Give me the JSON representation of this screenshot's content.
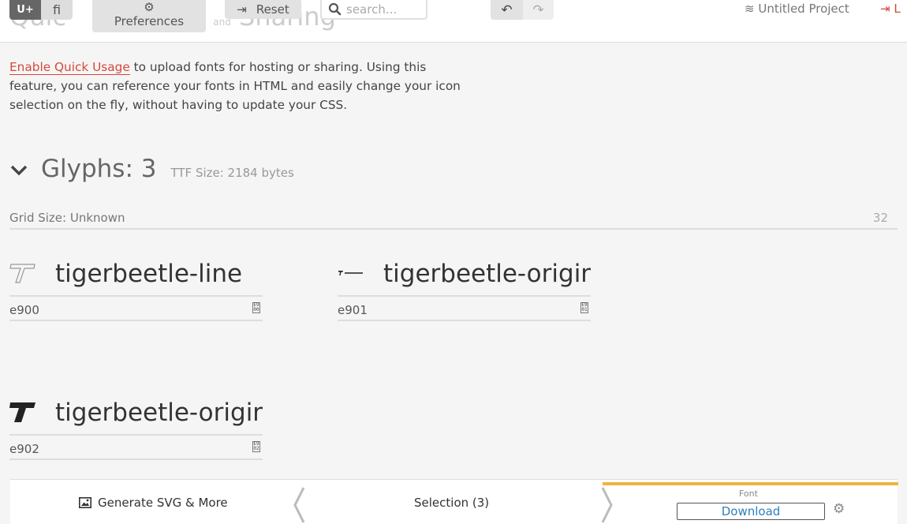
{
  "toolbar": {
    "unicode_btn": "U+",
    "ligature_btn": "ﬁ",
    "preferences_label": "Preferences",
    "reset_label": "Reset",
    "search_placeholder": "search...",
    "project_name": "Untitled Project",
    "login_label": "L"
  },
  "ghost": {
    "left": "Quic",
    "and": "and",
    "right": "Sharing"
  },
  "intro": {
    "link": "Enable Quick Usage",
    "text": " to upload fonts for hosting or sharing. Using this feature, you can reference your fonts in HTML and easily change your icon selection on the fly, without having to update your CSS."
  },
  "glyphs": {
    "title": "Glyphs: 3",
    "ttf_size": "TTF Size: 2184 bytes",
    "grid_size": "Grid Size: Unknown",
    "grid_number": "32",
    "items": [
      {
        "name": "tigerbeetle-line",
        "code": "e900",
        "badge_top": "E9",
        "badge_bottom": "00"
      },
      {
        "name": "tigerbeetle-original",
        "code": "e901",
        "badge_top": "E9",
        "badge_bottom": "01"
      },
      {
        "name": "tigerbeetle-original",
        "code": "e902",
        "badge_top": "E9",
        "badge_bottom": "02"
      }
    ]
  },
  "bottom": {
    "generate_label": "Generate SVG & More",
    "selection_label": "Selection (3)",
    "font_label": "Font",
    "download_label": "Download"
  },
  "colors": {
    "accent": "#d6473c",
    "download": "#2d7fbd",
    "font_panel_border": "#f0b43c"
  }
}
